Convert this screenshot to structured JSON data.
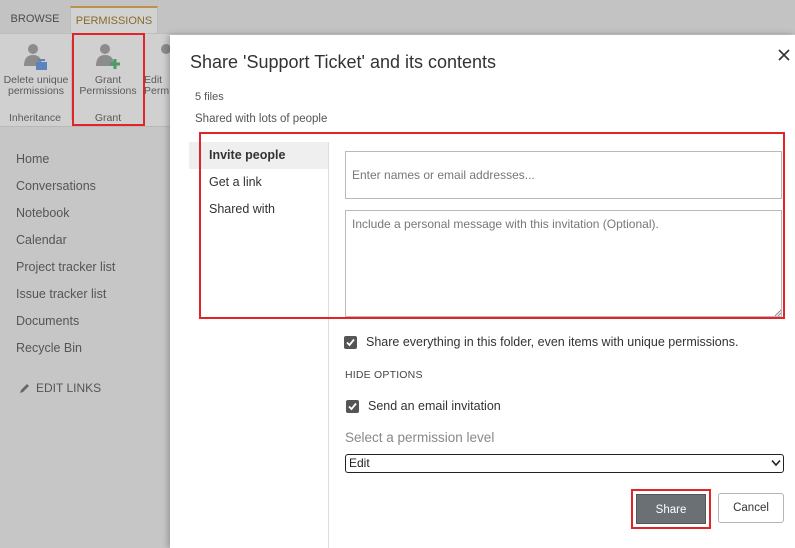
{
  "ribbon": {
    "tabs": [
      "BROWSE",
      "PERMISSIONS"
    ],
    "delete_unique_label": "Delete unique permissions",
    "grant_permissions_label": "Grant Permissions",
    "edit_permissions_label": "Edit Perm",
    "group_inheritance": "Inheritance",
    "group_grant": "Grant"
  },
  "leftnav": {
    "items": [
      "Home",
      "Conversations",
      "Notebook",
      "Calendar",
      "Project tracker list",
      "Issue tracker list",
      "Documents",
      "Recycle Bin"
    ],
    "edit_links": "EDIT LINKS"
  },
  "dialog": {
    "title": "Share 'Support Ticket' and its contents",
    "files_count": "5 files",
    "shared_with": "Shared with lots of people",
    "tabs": [
      "Invite people",
      "Get a link",
      "Shared with"
    ],
    "names_placeholder": "Enter names or email addresses...",
    "message_placeholder": "Include a personal message with this invitation (Optional).",
    "share_everything_label": "Share everything in this folder, even items with unique permissions.",
    "hide_options": "HIDE OPTIONS",
    "send_email_label": "Send an email invitation",
    "permission_level_label": "Select a permission level",
    "permission_level_value": "Edit",
    "share_button": "Share",
    "cancel_button": "Cancel"
  },
  "colors": {
    "highlight": "#e0242a",
    "share_button_bg": "#6a7074",
    "active_tab_bg": "#efefef"
  }
}
